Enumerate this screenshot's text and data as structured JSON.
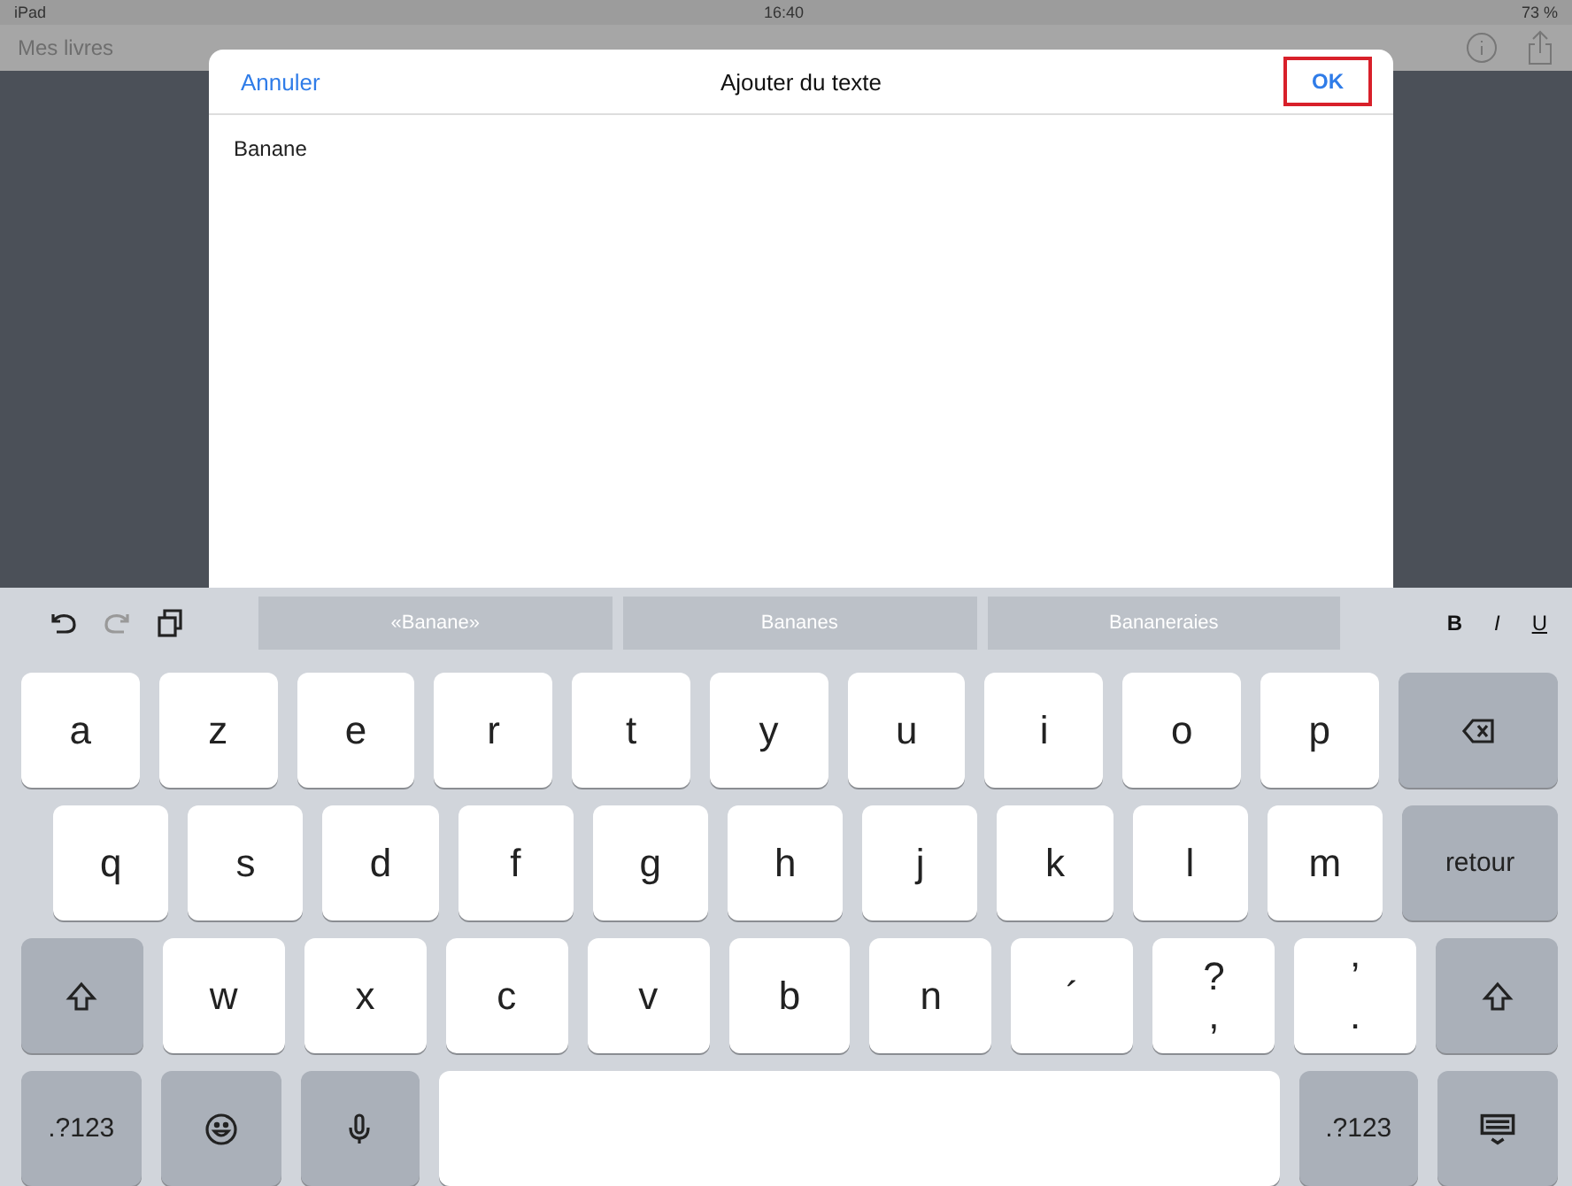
{
  "status_bar": {
    "carrier": "iPad",
    "time": "16:40",
    "battery": "73 %"
  },
  "nav_bar": {
    "back_label": "Mes livres"
  },
  "dialog": {
    "cancel": "Annuler",
    "title": "Ajouter du texte",
    "confirm": {
      "label": "OK",
      "highlighted": true
    },
    "text": "Banane"
  },
  "keyboard": {
    "suggestions": [
      "«Banane»",
      "Bananes",
      "Bananeraies"
    ],
    "format_buttons": [
      "B",
      "I",
      "U"
    ],
    "rows": [
      [
        {
          "kind": "letter",
          "label": "a"
        },
        {
          "kind": "letter",
          "label": "z"
        },
        {
          "kind": "letter",
          "label": "e"
        },
        {
          "kind": "letter",
          "label": "r"
        },
        {
          "kind": "letter",
          "label": "t"
        },
        {
          "kind": "letter",
          "label": "y"
        },
        {
          "kind": "letter",
          "label": "u"
        },
        {
          "kind": "letter",
          "label": "i"
        },
        {
          "kind": "letter",
          "label": "o"
        },
        {
          "kind": "letter",
          "label": "p"
        },
        {
          "kind": "delete"
        }
      ],
      [
        {
          "kind": "letter",
          "label": "q"
        },
        {
          "kind": "letter",
          "label": "s"
        },
        {
          "kind": "letter",
          "label": "d"
        },
        {
          "kind": "letter",
          "label": "f"
        },
        {
          "kind": "letter",
          "label": "g"
        },
        {
          "kind": "letter",
          "label": "h"
        },
        {
          "kind": "letter",
          "label": "j"
        },
        {
          "kind": "letter",
          "label": "k"
        },
        {
          "kind": "letter",
          "label": "l"
        },
        {
          "kind": "letter",
          "label": "m"
        },
        {
          "kind": "return",
          "label": "retour"
        }
      ],
      [
        {
          "kind": "shift"
        },
        {
          "kind": "letter",
          "label": "w"
        },
        {
          "kind": "letter",
          "label": "x"
        },
        {
          "kind": "letter",
          "label": "c"
        },
        {
          "kind": "letter",
          "label": "v"
        },
        {
          "kind": "letter",
          "label": "b"
        },
        {
          "kind": "letter",
          "label": "n"
        },
        {
          "kind": "letter",
          "label": "´"
        },
        {
          "kind": "dual",
          "label": "?",
          "sub": ","
        },
        {
          "kind": "dual",
          "label": "’",
          "sub": "."
        },
        {
          "kind": "shift"
        }
      ],
      [
        {
          "kind": "numbers",
          "label": ".?123"
        },
        {
          "kind": "emoji"
        },
        {
          "kind": "mic"
        },
        {
          "kind": "space"
        },
        {
          "kind": "numbers",
          "label": ".?123"
        },
        {
          "kind": "hide"
        }
      ]
    ]
  }
}
